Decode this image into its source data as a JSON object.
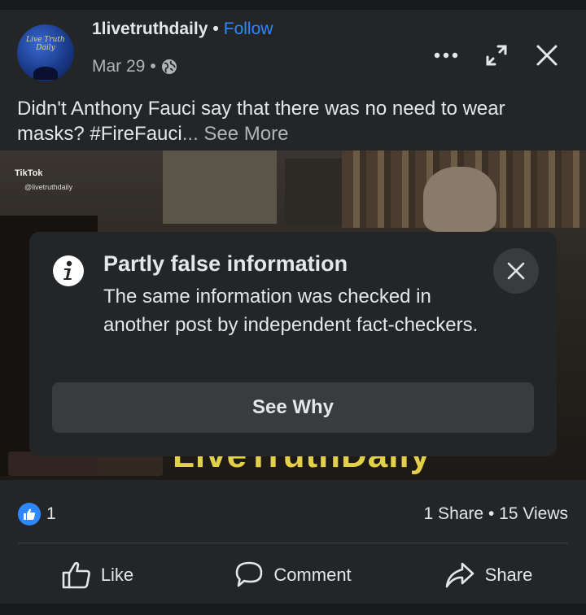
{
  "post": {
    "author": "1livetruthdaily",
    "separator": "•",
    "follow_label": "Follow",
    "date": "Mar 29",
    "date_sep": "•",
    "privacy_icon": "globe-icon",
    "avatar_text": "Live Truth Daily",
    "text": "Didn't Anthony Fauci say that there was no need to wear masks? #FireFauci",
    "see_more": "... See More"
  },
  "top_actions": {
    "more_icon": "more-horizontal-icon",
    "expand_icon": "expand-icon",
    "close_icon": "close-icon"
  },
  "media": {
    "tiktok_label": "TikTok",
    "tiktok_user": "@livetruthdaily",
    "watermark": "LiveTruthDaily"
  },
  "fact_check": {
    "title": "Partly false information",
    "body": "The same information was checked in another post by independent fact-checkers.",
    "button_label": "See Why",
    "info_icon": "info-icon",
    "close_icon": "close-icon"
  },
  "stats": {
    "like_count": "1",
    "shares": "1 Share",
    "sep": "•",
    "views": "15 Views"
  },
  "actions": {
    "like": "Like",
    "comment": "Comment",
    "share": "Share"
  },
  "colors": {
    "background": "#18191a",
    "card": "#242526",
    "accent": "#2d88ff",
    "text": "#e4e6eb",
    "secondary": "#b0b3b8",
    "button": "#3a3b3c",
    "watermark": "#e2d04a"
  }
}
